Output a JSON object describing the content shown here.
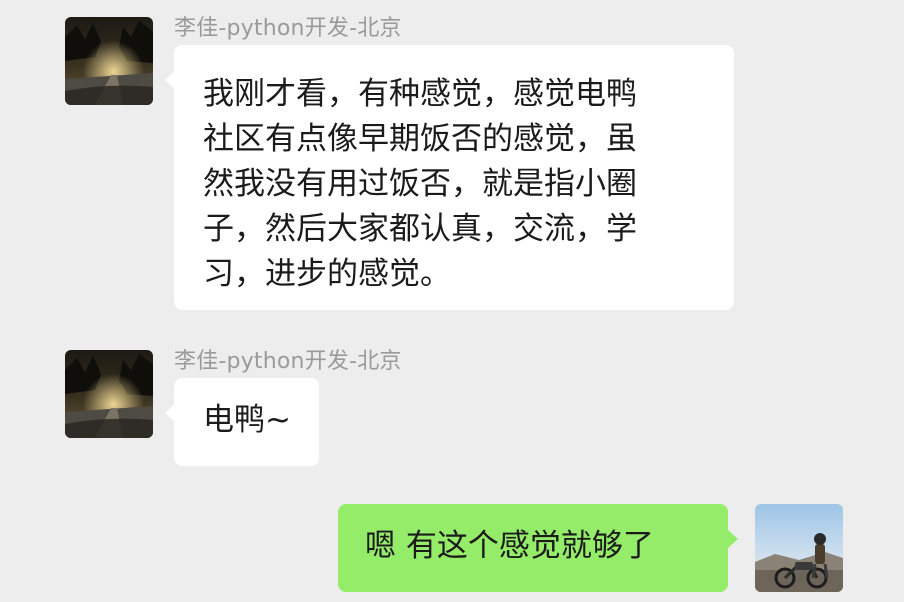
{
  "messages": [
    {
      "sender": "李佳-python开发-北京",
      "side": "left",
      "avatar": "night-road-avatar",
      "lines": [
        "我刚才看，有种感觉，感觉电鸭",
        "社区有点像早期饭否的感觉，虽",
        "然我没有用过饭否，就是指小圈",
        "子，然后大家都认真，交流，学",
        "习，进步的感觉。"
      ]
    },
    {
      "sender": "李佳-python开发-北京",
      "side": "left",
      "avatar": "night-road-avatar",
      "text": "电鸭~"
    },
    {
      "side": "right",
      "avatar": "motorcycle-rider-avatar",
      "text": "嗯 有这个感觉就够了"
    }
  ],
  "colors": {
    "background": "#ededed",
    "incoming_bubble": "#ffffff",
    "outgoing_bubble": "#95ec69",
    "sender_name": "#9a9a9a"
  }
}
